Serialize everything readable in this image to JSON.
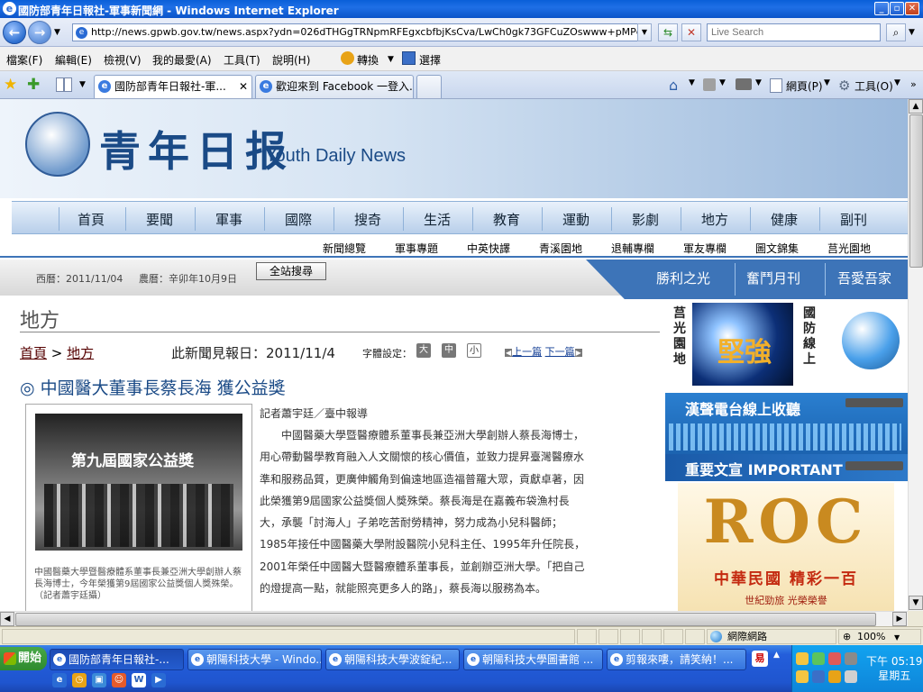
{
  "window": {
    "title": "國防部青年日報社-軍事新聞網 - Windows Internet Explorer",
    "min_label": "_",
    "max_label": "▫",
    "close_label": "✕"
  },
  "addressbar": {
    "url": "http://news.gpwb.gov.tw/news.aspx?ydn=026dTHGgTRNpmRFEgxcbfbjKsCva/LwCh0gk73GFCuZOswww+pMPcdDhIh1TiELyf",
    "search_placeholder": "Live Search"
  },
  "menubar": {
    "items": [
      "檔案(F)",
      "編輯(E)",
      "檢視(V)",
      "我的最愛(A)",
      "工具(T)",
      "說明(H)"
    ],
    "convert": "轉換",
    "select": "選擇"
  },
  "tabs": {
    "items": [
      {
        "label": "國防部青年日報社-軍..."
      },
      {
        "label": "歡迎來到 Facebook 一登入..."
      }
    ],
    "toolbar_page": "網頁(P)",
    "toolbar_tools": "工具(O)"
  },
  "site": {
    "logo_text": "青年日报",
    "logo_en": "Youth Daily News",
    "main_nav": [
      "首頁",
      "要聞",
      "軍事",
      "國際",
      "搜奇",
      "生活",
      "教育",
      "運動",
      "影劇",
      "地方",
      "健康",
      "副刊"
    ],
    "sub_nav": [
      "新聞總覽",
      "軍事專題",
      "中英快譯",
      "青溪園地",
      "退輔專欄",
      "軍友專欄",
      "圖文錦集",
      "莒光園地"
    ],
    "date_western": "西曆：2011/11/04",
    "date_lunar": "農曆：辛卯年10月9日",
    "site_search": "全站搜尋",
    "blue_tabs": [
      "勝利之光",
      "奮鬥月刊",
      "吾愛吾家"
    ]
  },
  "article": {
    "section_title": "地方",
    "crumb_home": "首頁",
    "crumb_sep": " > ",
    "crumb_section": "地方",
    "pub_date": "此新聞見報日：2011/11/4",
    "font_setting": "字體設定：",
    "font_sizes": [
      "大",
      "中",
      "小"
    ],
    "prev": "上一篇",
    "next": "下一篇",
    "headline": "◎ 中國醫大董事長蔡長海 獲公益獎",
    "photo_banner": "第九屆國家公益獎",
    "photo_caption": "中國醫藥大學暨醫療體系董事長兼亞洲大學創辦人蔡長海博士，今年榮獲第9屆國家公益獎個人獎殊榮。（記者蕭宇廷攝）",
    "byline": "記者蕭宇廷／臺中報導",
    "body": "中國醫藥大學暨醫療體系董事長兼亞洲大學創辦人蔡長海博士，用心帶動醫學教育融入人文關懷的核心價值，並致力提昇臺灣醫療水準和服務品質，更廣伸觸角到偏遠地區造福普羅大眾，貢獻卓著，因此榮獲第9屆國家公益獎個人獎殊榮。蔡長海是在嘉義布袋漁村長大，承襲「討海人」子弟吃苦耐勞精神，努力成為小兒科醫師；1985年接任中國醫藥大學附設醫院小兒科主任、1995年升任院長，2001年榮任中國醫大暨醫療體系董事長，並創辦亞洲大學。「把自己的燈提高一點，就能照亮更多人的路」，蔡長海以服務為本。"
  },
  "sidebar": {
    "label_1": "莒光園地",
    "label_2": "國防線上",
    "banner_1": "堅強",
    "radio": "漢聲電台線上收聽",
    "important": "重要文宣 IMPORTANT",
    "roc": "ROC",
    "roc_slogan": "中華民國 精彩一百",
    "roc_small": "世紀勁旅 光榮榮譽"
  },
  "statusbar": {
    "zone": "網際網路",
    "zoom": "100%"
  },
  "taskbar": {
    "start": "開始",
    "buttons": [
      "國防部青年日報社-...",
      "朝陽科技大學 - Windo...",
      "朝陽科技大學波錠紀...",
      "朝陽科技大學圖書館 ...",
      "剪報來嘍，請笑納！..."
    ],
    "time": "下午 05:19",
    "day": "星期五"
  }
}
